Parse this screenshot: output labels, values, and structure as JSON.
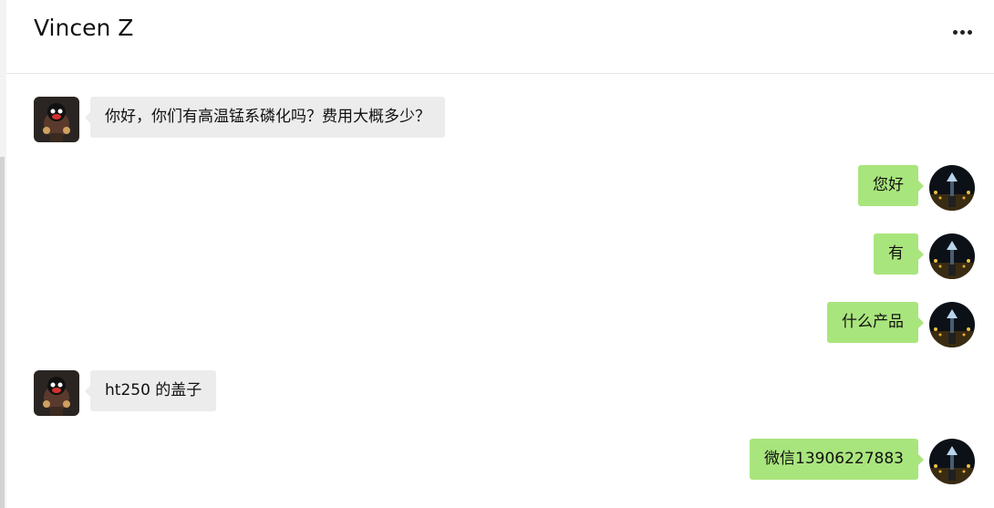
{
  "header": {
    "title": "Vincen Z",
    "more_icon": "more-horizontal-icon"
  },
  "colors": {
    "incoming_bubble": "#ececec",
    "outgoing_bubble": "#a9e57d"
  },
  "messages": [
    {
      "from": "contact",
      "text": "你好，你们有高温锰系磷化吗？费用大概多少？"
    },
    {
      "from": "me",
      "text": "您好"
    },
    {
      "from": "me",
      "text": "有"
    },
    {
      "from": "me",
      "text": "什么产品"
    },
    {
      "from": "contact",
      "text": "ht250 的盖子"
    },
    {
      "from": "me",
      "text": "微信13906227883"
    }
  ]
}
